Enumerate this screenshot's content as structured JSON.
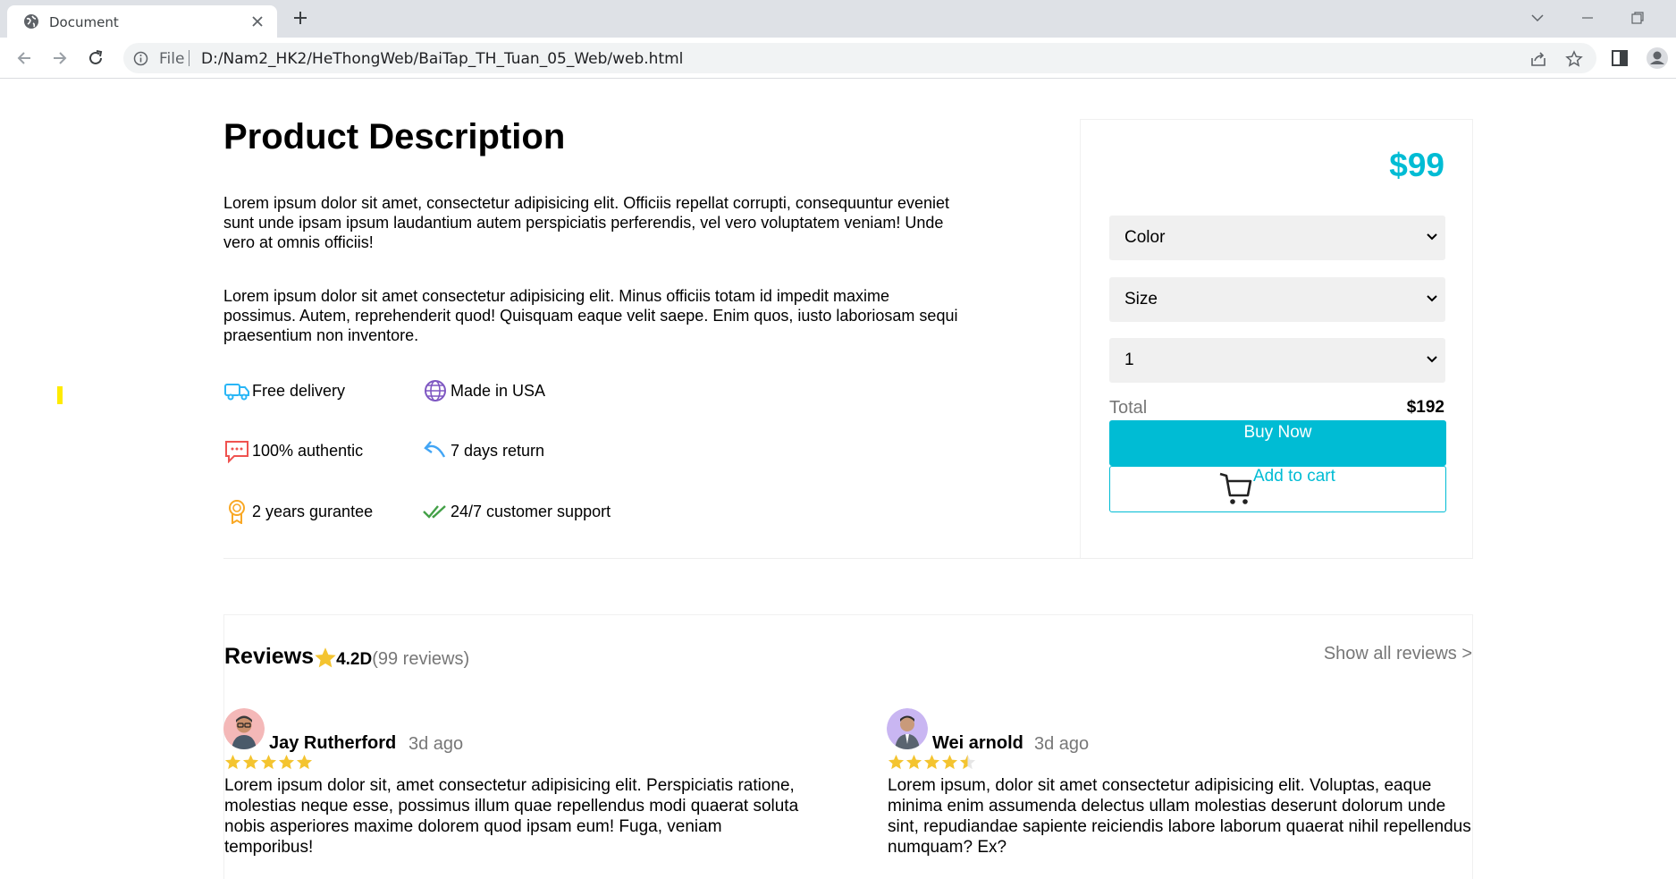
{
  "browser": {
    "tab_title": "Document",
    "address_scheme": "File",
    "address_url": "D:/Nam2_HK2/HeThongWeb/BaiTap_TH_Tuan_05_Web/web.html"
  },
  "product": {
    "title": "Product Description",
    "paragraphs": [
      "Lorem ipsum dolor sit amet, consectetur adipisicing elit. Officiis repellat corrupti, consequuntur eveniet sunt unde ipsam ipsum laudantium autem perspiciatis perferendis, vel vero voluptatem veniam! Unde vero at omnis officiis!",
      "Lorem ipsum dolor sit amet consectetur adipisicing elit. Minus officiis totam id impedit maxime possimus. Autem, reprehenderit quod! Quisquam eaque velit saepe. Enim quos, iusto laboriosam sequi praesentium non inventore."
    ],
    "features": [
      {
        "label": "Free delivery",
        "icon": "truck-icon",
        "color": "#29b6f6"
      },
      {
        "label": "Made in USA",
        "icon": "globe-icon",
        "color": "#7e57c2"
      },
      {
        "label": "100% authentic",
        "icon": "chat-icon",
        "color": "#ef5350"
      },
      {
        "label": "7 days return",
        "icon": "return-arrow-icon",
        "color": "#42a5f5"
      },
      {
        "label": "2 years gurantee",
        "icon": "award-icon",
        "color": "#f9a825"
      },
      {
        "label": "24/7 customer support",
        "icon": "double-check-icon",
        "color": "#43a047"
      }
    ]
  },
  "buybox": {
    "price": "$99",
    "selects": [
      {
        "selected": "Color"
      },
      {
        "selected": "Size"
      },
      {
        "selected": "1"
      }
    ],
    "total_label": "Total",
    "total_value": "$192",
    "buy_label": "Buy Now",
    "cart_label": "Add to cart",
    "accent_color": "#00bcd4"
  },
  "reviews": {
    "title": "Reviews",
    "rating": "4.2D",
    "count": "(99 reviews)",
    "show_all": "Show all reviews >",
    "items": [
      {
        "name": "Jay Rutherford",
        "time": "3d ago",
        "stars": 5,
        "text": "Lorem ipsum dolor sit, amet consectetur adipisicing elit. Perspiciatis ratione, molestias neque esse, possimus illum quae repellendus modi quaerat soluta nobis asperiores maxime dolorem quod ipsam eum! Fuga, veniam temporibus!"
      },
      {
        "name": "Wei arnold",
        "time": "3d ago",
        "stars": 4.5,
        "text": "Lorem ipsum, dolor sit amet consectetur adipisicing elit. Voluptas, eaque minima enim assumenda delectus ullam molestias deserunt dolorum unde sint, repudiandae sapiente reiciendis labore laborum quaerat nihil repellendus numquam? Ex?"
      }
    ]
  }
}
